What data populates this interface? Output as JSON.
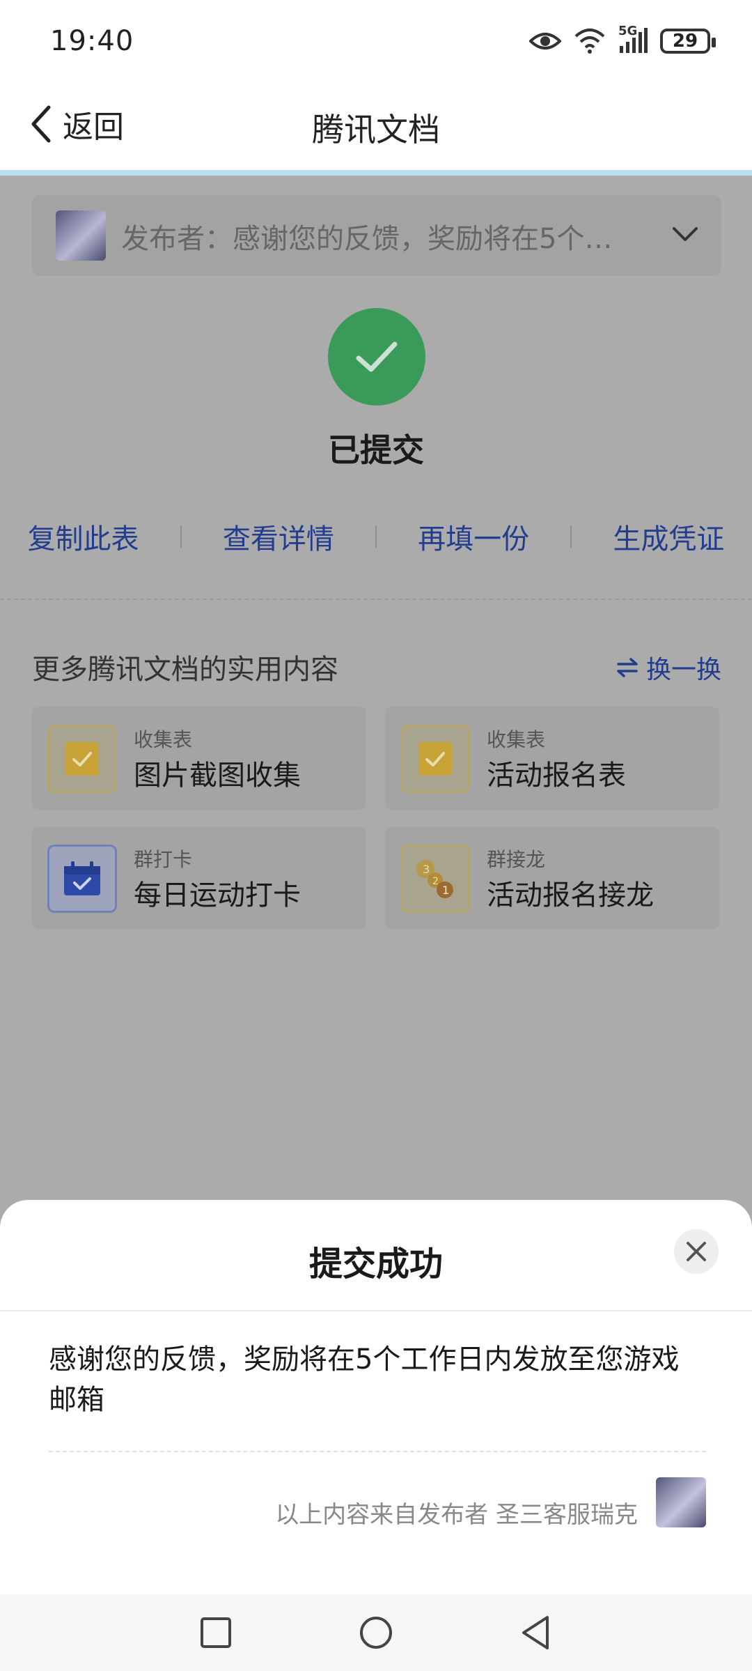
{
  "status_bar": {
    "time": "19:40",
    "network": "5G",
    "battery": "29"
  },
  "nav": {
    "back_label": "返回",
    "title": "腾讯文档"
  },
  "publisher": {
    "text": "发布者：感谢您的反馈，奖励将在5个…"
  },
  "status": {
    "title": "已提交"
  },
  "actions": [
    "复制此表",
    "查看详情",
    "再填一份",
    "生成凭证"
  ],
  "more": {
    "title": "更多腾讯文档的实用内容",
    "swap_label": "换一换",
    "cards": [
      {
        "category": "收集表",
        "name": "图片截图收集",
        "icon": "checkbox-icon"
      },
      {
        "category": "收集表",
        "name": "活动报名表",
        "icon": "checkbox-icon"
      },
      {
        "category": "群打卡",
        "name": "每日运动打卡",
        "icon": "calendar-icon"
      },
      {
        "category": "群接龙",
        "name": "活动报名接龙",
        "icon": "number-bubbles-icon"
      }
    ]
  },
  "sheet": {
    "title": "提交成功",
    "message": "感谢您的反馈，奖励将在5个工作日内发放至您游戏邮箱",
    "source": "以上内容来自发布者 圣三客服瑞克"
  },
  "colors": {
    "link": "#233d8e",
    "success": "#3a9a5a",
    "overlay": "#ababab"
  }
}
